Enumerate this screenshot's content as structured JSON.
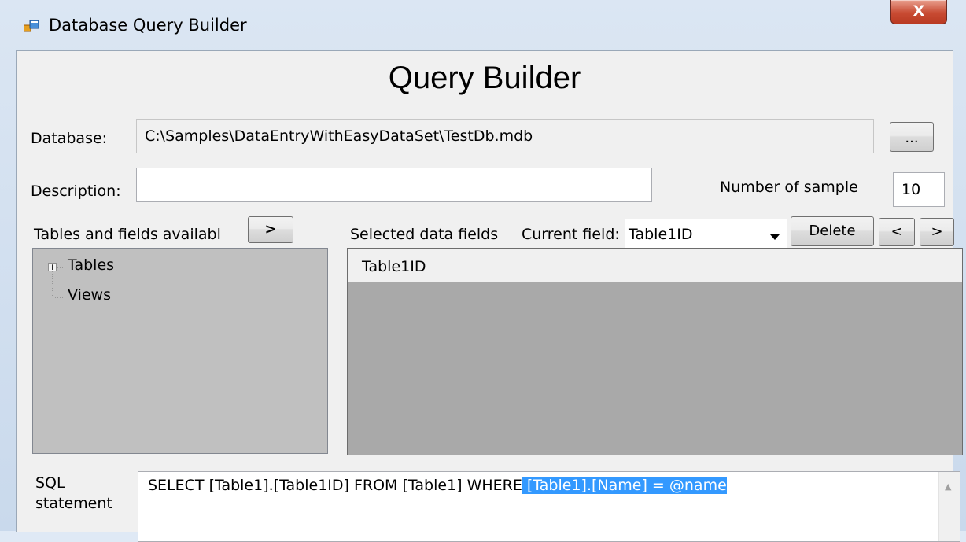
{
  "window": {
    "title": "Database Query Builder",
    "close_label": "X"
  },
  "heading": "Query Builder",
  "database": {
    "label": "Database:",
    "value": "C:\\Samples\\DataEntryWithEasyDataSet\\TestDb.mdb",
    "browse_label": "..."
  },
  "description": {
    "label": "Description:",
    "value": ""
  },
  "sample": {
    "label": "Number of sample",
    "value": "10"
  },
  "tables_panel": {
    "label": "Tables and fields availabl",
    "add_label": ">",
    "tree": [
      {
        "label": "Tables",
        "expander": "+"
      },
      {
        "label": "Views"
      }
    ]
  },
  "selected_panel": {
    "label": "Selected data fields",
    "current_field_label": "Current field:",
    "current_field_value": "Table1ID",
    "delete_label": "Delete",
    "prev_label": "<",
    "next_label": ">",
    "rows": [
      "Table1ID"
    ]
  },
  "sql": {
    "label_line1": "SQL",
    "label_line2": "statement",
    "text_plain": "SELECT  [Table1].[Table1ID] FROM [Table1] WHERE",
    "text_selected": " [Table1].[Name] = @name",
    "scroll_up": "▲"
  },
  "colors": {
    "selection": "#3399ff",
    "close_button": "#c84b33",
    "tree_background": "#c0c0c0",
    "grid_background": "#a9a9a9"
  }
}
